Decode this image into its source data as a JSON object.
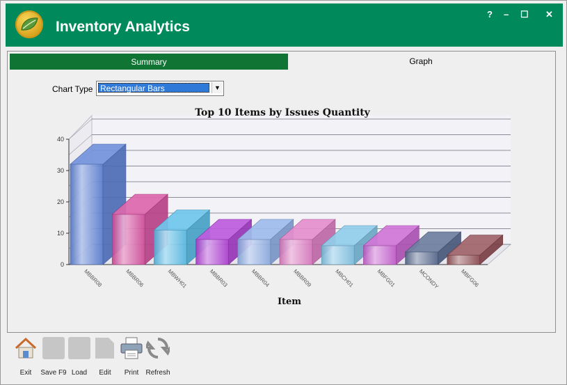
{
  "window": {
    "title": "Inventory Analytics",
    "help_label": "?",
    "minimize_label": "–",
    "maximize_label": "☐",
    "close_label": "✕"
  },
  "tabs": [
    {
      "label": "Summary"
    },
    {
      "label": "Graph"
    }
  ],
  "controls": {
    "chart_type_label": "Chart Type",
    "chart_type_value": "Rectangular Bars"
  },
  "chart_data": {
    "type": "bar",
    "style": "3d",
    "title": "Top 10 Items by Issues Quantity",
    "xlabel": "Item",
    "ylabel": "",
    "ylim": [
      0,
      40
    ],
    "yticks": [
      0,
      10,
      20,
      30,
      40
    ],
    "categories": [
      "MBBR08",
      "MBBR06",
      "MBWH01",
      "MBBR03",
      "MBBR04",
      "MBBR09",
      "MBCH01",
      "MBFG01",
      "MCONDY",
      "MBFG06"
    ],
    "values": [
      32,
      16,
      11,
      8,
      8,
      8,
      6,
      6,
      4,
      3
    ],
    "colors": [
      "#5b80d6",
      "#d64c9e",
      "#55bde8",
      "#b13ed6",
      "#8fb0e8",
      "#e07ac4",
      "#7ec4e6",
      "#c85ed0",
      "#55688e",
      "#8f4a50"
    ],
    "grid": true,
    "legend": "none"
  },
  "toolbar": [
    {
      "label": "Exit",
      "icon": "home-icon"
    },
    {
      "label": "Save F9",
      "icon": "save-icon"
    },
    {
      "label": "Load",
      "icon": "load-icon"
    },
    {
      "label": "Edit",
      "icon": "edit-icon"
    },
    {
      "label": "Print",
      "icon": "printer-icon"
    },
    {
      "label": "Refresh",
      "icon": "refresh-icon"
    }
  ]
}
